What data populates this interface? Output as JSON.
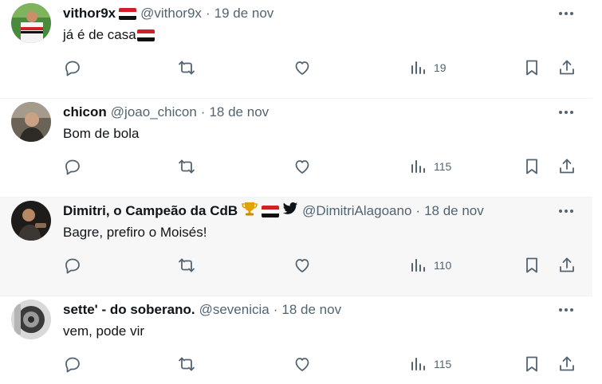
{
  "colors": {
    "text": "#0f1419",
    "secondary": "#536471",
    "highlight_bg": "#f7f7f7",
    "divider": "#eff3f4"
  },
  "icons": {
    "reply": "reply-icon",
    "repost": "repost-icon",
    "like": "heart-icon",
    "views": "views-bar-chart-icon",
    "bookmark": "bookmark-icon",
    "share": "share-icon",
    "more": "more-dots-icon"
  },
  "tweets": [
    {
      "name": "vithor9x",
      "handle": "@vithor9x",
      "separator": "·",
      "date": "19 de nov",
      "text": "já é de casa",
      "views": "19"
    },
    {
      "name": "chicon",
      "handle": "@joao_chicon",
      "separator": "·",
      "date": "18 de nov",
      "text": "Bom de bola",
      "views": "115"
    },
    {
      "name": "Dimitri, o Campeão da CdB",
      "handle": "@DimitriAlagoano",
      "separator": "·",
      "date": "18 de nov",
      "text": "Bagre, prefiro o Moisés!",
      "views": "110"
    },
    {
      "name": "sette' - do soberano.",
      "handle": "@sevenicia",
      "separator": "·",
      "date": "18 de nov",
      "text": "vem, pode vir",
      "views": "115"
    }
  ]
}
